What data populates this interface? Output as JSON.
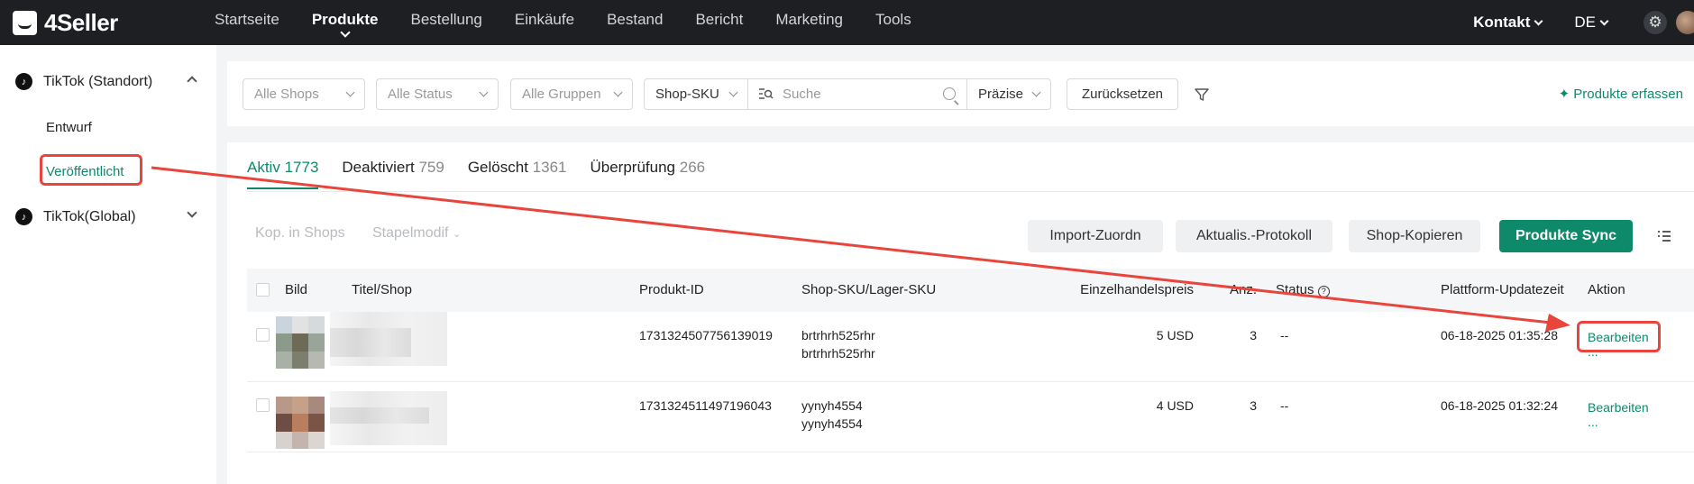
{
  "app": {
    "name": "4Seller"
  },
  "nav": [
    {
      "label": "Startseite",
      "active": false
    },
    {
      "label": "Produkte",
      "active": true
    },
    {
      "label": "Bestellung",
      "active": false
    },
    {
      "label": "Einkäufe",
      "active": false
    },
    {
      "label": "Bestand",
      "active": false
    },
    {
      "label": "Bericht",
      "active": false
    },
    {
      "label": "Marketing",
      "active": false
    },
    {
      "label": "Tools",
      "active": false
    }
  ],
  "topright": {
    "contact": "Kontakt",
    "lang": "DE"
  },
  "sidebar": {
    "group1": "TikTok (Standort)",
    "sub1": "Entwurf",
    "sub2": "Veröffentlicht",
    "group2": "TikTok(Global)"
  },
  "filters": {
    "shops": "Alle Shops",
    "status": "Alle Status",
    "groups": "Alle Gruppen",
    "sku_type": "Shop-SKU",
    "search_placeholder": "Suche",
    "precision": "Präzise",
    "reset": "Zurücksetzen",
    "capture": "Produkte erfassen"
  },
  "tabs": [
    {
      "label": "Aktiv",
      "count": "1773",
      "active": true
    },
    {
      "label": "Deaktiviert",
      "count": "759",
      "active": false
    },
    {
      "label": "Gelöscht",
      "count": "1361",
      "active": false
    },
    {
      "label": "Überprüfung",
      "count": "266",
      "active": false
    }
  ],
  "toolbar": {
    "copy_to_shops": "Kop. in Shops",
    "batch_edit": "Stapelmodif",
    "import_map": "Import-Zuordn",
    "update_log": "Aktualis.-Protokoll",
    "shop_copy": "Shop-Kopieren",
    "sync": "Produkte Sync"
  },
  "table": {
    "headers": {
      "image": "Bild",
      "title": "Titel/Shop",
      "product_id": "Produkt-ID",
      "sku": "Shop-SKU/Lager-SKU",
      "price": "Einzelhandelspreis",
      "qty": "Anz.",
      "status": "Status",
      "updated": "Plattform-Updatezeit",
      "action": "Aktion"
    },
    "rows": [
      {
        "product_id": "1731324507756139019",
        "sku1": "brtrhrh525rhr",
        "sku2": "brtrhrh525rhr",
        "price": "5 USD",
        "qty": "3",
        "status": "--",
        "updated": "06-18-2025 01:35:28",
        "edit": "Bearbeiten",
        "more": "..."
      },
      {
        "product_id": "1731324511497196043",
        "sku1": "yynyh4554",
        "sku2": "yynyh4554",
        "price": "4 USD",
        "qty": "3",
        "status": "--",
        "updated": "06-18-2025 01:32:24",
        "edit": "Bearbeiten",
        "more": "..."
      }
    ]
  },
  "colors": {
    "accent": "#0e8a6a",
    "highlight": "#e8453c",
    "topbar": "#1d1f23"
  }
}
